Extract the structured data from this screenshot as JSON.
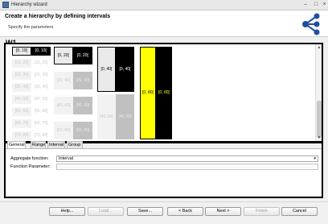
{
  "window": {
    "title": "Hierarchy wizard"
  },
  "header": {
    "title": "Create a hierarchy by defining intervals",
    "subtitle": "Specify the parameters"
  },
  "w1": {
    "label": "W1",
    "levels": [
      {
        "first_row": [
          "[0, 10[",
          "[0, 10["
        ],
        "faded_rows": [
          "[10, 20[",
          "[20, 30[",
          "[30, 40[",
          "[40, 50[",
          "[50, 60[",
          "[60, 70[",
          "[70, 80["
        ],
        "faded_rows_right": [
          "[10, 20[",
          "[20, 30[",
          "[30, 40[",
          "[40, 50[",
          "[50, 60[",
          "[60, 70[",
          "[70, 80["
        ]
      },
      {
        "first_row": [
          "[0, 20[",
          "[0, 20["
        ],
        "faded_rows": [
          "[20, 40[",
          "[40, 60[",
          "[60, 80["
        ],
        "faded_rows_right": [
          "[20, 40[",
          "[40, 60[",
          "[60, 80["
        ]
      },
      {
        "first_row": [
          "[0, 40[",
          "[0, 40["
        ],
        "faded_rows": [
          "[40, 80["
        ],
        "faded_rows_right": [
          "[40, 80["
        ]
      },
      {
        "first_row": [
          "[0, 80[",
          "[0, 80["
        ]
      }
    ]
  },
  "w2": {
    "label": "W2",
    "tabs": [
      "General",
      "Range",
      "Interval",
      "Group"
    ],
    "active_tab": "General",
    "aggregate_label": "Aggregate function:",
    "aggregate_value": "Interval",
    "function_param_label": "Function Parameter:",
    "function_param_value": ""
  },
  "footer": {
    "help": "Help...",
    "load": "Load...",
    "save": "Save...",
    "back": "< Back",
    "next": "Next >",
    "finish": "Finish",
    "cancel": "Cancel"
  },
  "colors": {
    "highlight_yellow": "#ffff00",
    "black": "#000000",
    "faded_text": "#c8c8c8",
    "faded_bg": "#f2f2f2",
    "selected_bg": "#eaeaea"
  },
  "icons": {
    "app": "app-icon",
    "wizard": "hierarchy-network-icon"
  }
}
